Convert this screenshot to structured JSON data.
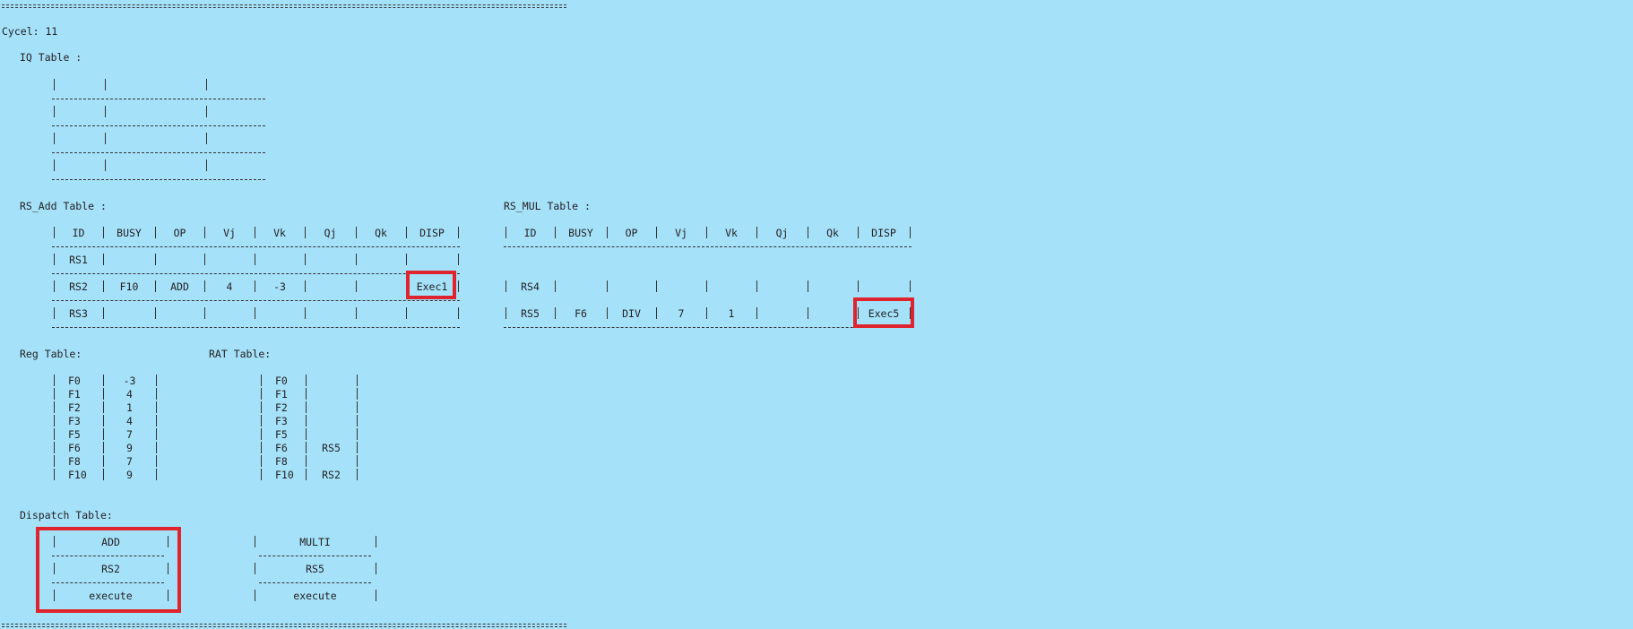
{
  "cycle_label": "Cycel: 11",
  "iq": {
    "title": "IQ Table :"
  },
  "rs_add": {
    "title": "RS_Add Table :",
    "headers": [
      "ID",
      "BUSY",
      "OP",
      "Vj",
      "Vk",
      "Qj",
      "Qk",
      "DISP"
    ],
    "rows": [
      [
        "RS1",
        "",
        "",
        "",
        "",
        "",
        "",
        ""
      ],
      [
        "RS2",
        "F10",
        "ADD",
        "4",
        "-3",
        "",
        "",
        "Exec1"
      ],
      [
        "RS3",
        "",
        "",
        "",
        "",
        "",
        "",
        ""
      ]
    ]
  },
  "rs_mul": {
    "title": "RS_MUL Table :",
    "headers": [
      "ID",
      "BUSY",
      "OP",
      "Vj",
      "Vk",
      "Qj",
      "Qk",
      "DISP"
    ],
    "rows": [
      [
        "RS4",
        "",
        "",
        "",
        "",
        "",
        "",
        ""
      ],
      [
        "RS5",
        "F6",
        "DIV",
        "7",
        "1",
        "",
        "",
        "Exec5"
      ]
    ]
  },
  "reg": {
    "title": "Reg Table:",
    "rows": [
      [
        "F0",
        "-3"
      ],
      [
        "F1",
        "4"
      ],
      [
        "F2",
        "1"
      ],
      [
        "F3",
        "4"
      ],
      [
        "F5",
        "7"
      ],
      [
        "F6",
        "9"
      ],
      [
        "F8",
        "7"
      ],
      [
        "F10",
        "9"
      ]
    ]
  },
  "rat": {
    "title": "RAT Table:",
    "rows": [
      [
        "F0",
        ""
      ],
      [
        "F1",
        ""
      ],
      [
        "F2",
        ""
      ],
      [
        "F3",
        ""
      ],
      [
        "F5",
        ""
      ],
      [
        "F6",
        "RS5"
      ],
      [
        "F8",
        ""
      ],
      [
        "F10",
        "RS2"
      ]
    ]
  },
  "dispatch": {
    "title": "Dispatch Table:",
    "add": [
      "ADD",
      "RS2",
      "execute"
    ],
    "multi": [
      "MULTI",
      "RS5",
      "execute"
    ]
  },
  "highlight_color": "#e0242e",
  "background_color": "#a6e1fa"
}
